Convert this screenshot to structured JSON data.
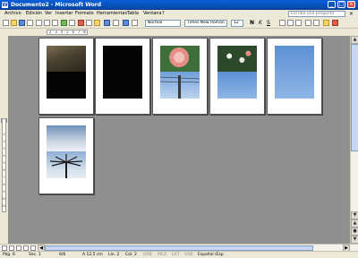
{
  "window": {
    "title": "Documento2 - Microsoft Word",
    "app_icon": "word-icon",
    "controls": [
      "_",
      "□",
      "×"
    ]
  },
  "menu": {
    "items": [
      "Archivo",
      "Edición",
      "Ver",
      "Insertar",
      "Formato",
      "Herramientas",
      "Tabla",
      "Ventana",
      "?"
    ],
    "help_placeholder": "Escriba una pregunta",
    "close_doc": "×"
  },
  "toolbar": {
    "style": "Normal",
    "font": "Times New Roman",
    "size": "12",
    "bold": "N",
    "italic": "K",
    "underline": "S"
  },
  "ruler": {
    "horizontal_marks": "2 · 3 · 4 · 5 · 6 · 7 · 8 · 9 · 10 · 11 · 12 · 13 · 14 · 15",
    "vertical_marks": [
      "1",
      "2",
      "3",
      "4",
      "5",
      "6",
      "7",
      "8",
      "9",
      "10",
      "11"
    ]
  },
  "document": {
    "pages": [
      {
        "top": "hand-photo",
        "bottom": "dark-photo"
      },
      {
        "top": "black-photo",
        "bottom": "black-photo"
      },
      {
        "top": "hibiscus-photo",
        "bottom": "powerline-sky-photo"
      },
      {
        "top": "flower-bush-photo",
        "bottom": "blue-sky-photo"
      },
      {
        "full": "blue-sky-full-photo"
      },
      {
        "top": "cloudy-sky-photo",
        "bottom": "palm-tree-photo"
      }
    ]
  },
  "status": {
    "page": "Pág. 6",
    "section": "Sec. 1",
    "pages": "6/6",
    "position": "A 12,5 cm",
    "line": "Lín. 2",
    "column": "Col. 2",
    "modes": [
      "GRB",
      "MCA",
      "EXT",
      "SOB"
    ],
    "language": "Español (Esp"
  }
}
